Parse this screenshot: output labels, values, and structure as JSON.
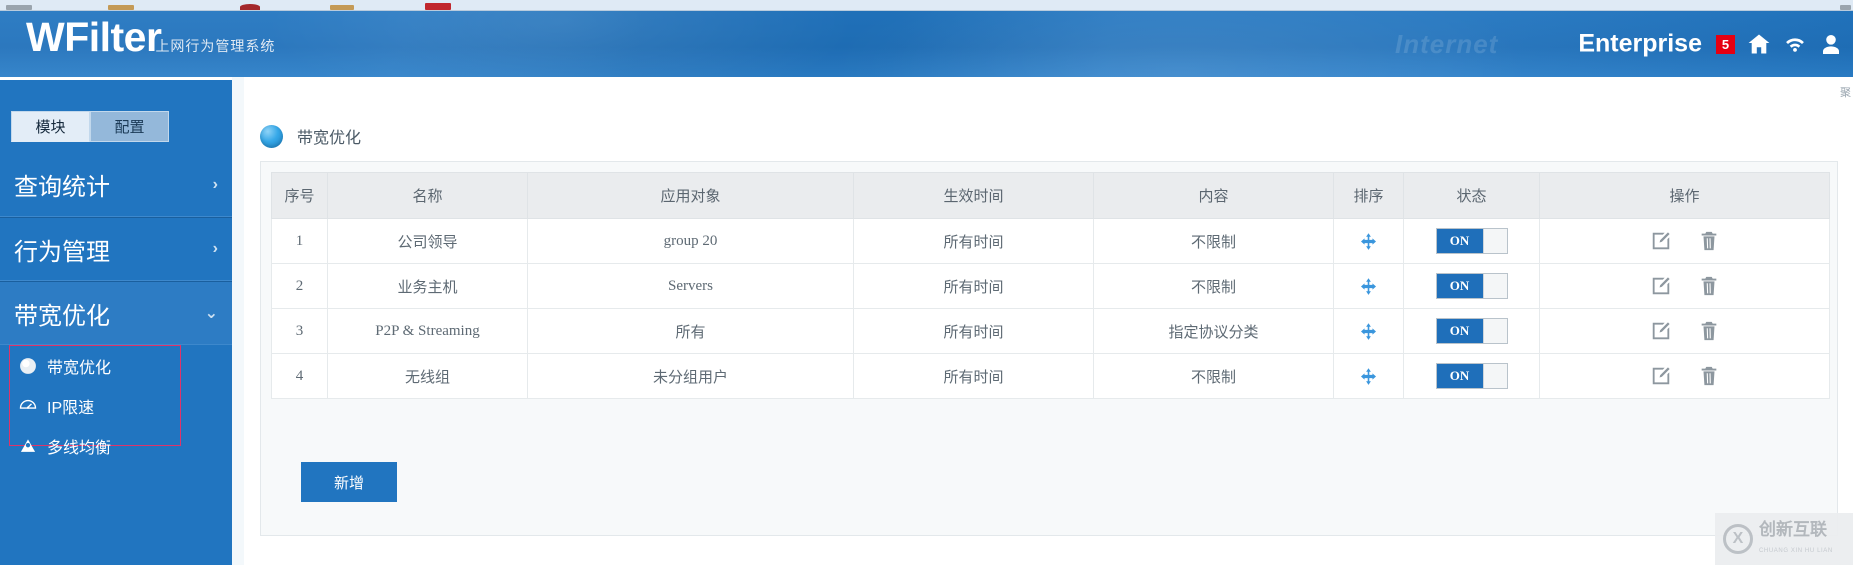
{
  "browser_strip": {
    "present": true
  },
  "header": {
    "brand_name": "WFilter",
    "brand_subtitle": "上网行为管理系统",
    "background_watermark": "Internet",
    "edition": "Enterprise",
    "alert_count": "5",
    "icons": [
      "home-icon",
      "wifi-icon",
      "user-icon"
    ],
    "colors": {
      "bar": "#2175c0",
      "badge": "#e60012",
      "text": "#ffffff"
    }
  },
  "sidebar": {
    "tabs": [
      {
        "label": "模块",
        "active": true
      },
      {
        "label": "配置",
        "active": false
      }
    ],
    "groups": [
      {
        "label": "查询统计",
        "chevron": "›",
        "expanded": false
      },
      {
        "label": "行为管理",
        "chevron": "›",
        "expanded": false
      },
      {
        "label": "带宽优化",
        "chevron": "⌄",
        "expanded": true
      }
    ],
    "submenu": [
      {
        "label": "带宽优化",
        "icon": "sphere-icon"
      },
      {
        "label": "IP限速",
        "icon": "gauge-icon"
      },
      {
        "label": "多线均衡",
        "icon": "network-triangle-icon"
      }
    ],
    "submenu_highlight_color": "#e0346a",
    "collapse_handle": "◀"
  },
  "content": {
    "corner_label": "聚",
    "page_title": "带宽优化",
    "table": {
      "headers": [
        "序号",
        "名称",
        "应用对象",
        "生效时间",
        "内容",
        "排序",
        "状态",
        "操作"
      ],
      "rows": [
        {
          "index": "1",
          "name": "公司领导",
          "object": "group 20",
          "time": "所有时间",
          "content": "不限制",
          "sort": "move-icon",
          "state": "ON",
          "ops": [
            "edit-icon",
            "delete-icon"
          ]
        },
        {
          "index": "2",
          "name": "业务主机",
          "object": "Servers",
          "time": "所有时间",
          "content": "不限制",
          "sort": "move-icon",
          "state": "ON",
          "ops": [
            "edit-icon",
            "delete-icon"
          ]
        },
        {
          "index": "3",
          "name": "P2P & Streaming",
          "object": "所有",
          "time": "所有时间",
          "content": "指定协议分类",
          "sort": "move-icon",
          "state": "ON",
          "ops": [
            "edit-icon",
            "delete-icon"
          ]
        },
        {
          "index": "4",
          "name": "无线组",
          "object": "未分组用户",
          "time": "所有时间",
          "content": "不限制",
          "sort": "move-icon",
          "state": "ON",
          "ops": [
            "edit-icon",
            "delete-icon"
          ]
        }
      ]
    },
    "add_button": "新增"
  },
  "watermark": {
    "logo_letter": "X",
    "name_cn": "创新互联",
    "name_py": "CHUANG XIN HU LIAN"
  }
}
